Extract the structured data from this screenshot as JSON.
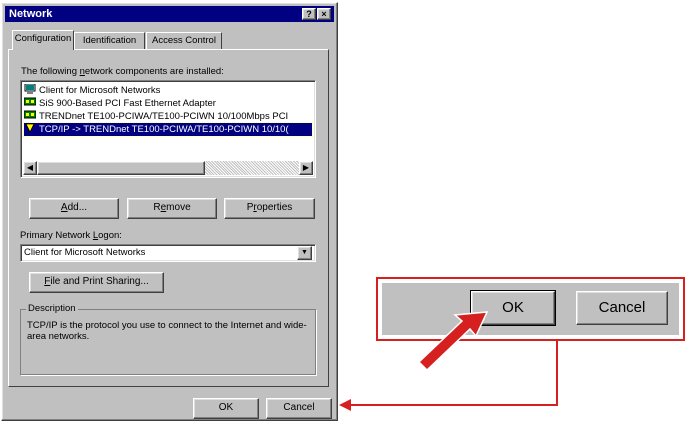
{
  "window": {
    "title": "Network",
    "help_label": "?",
    "close_label": "×"
  },
  "tabs": [
    {
      "label": "Configuration",
      "active": true
    },
    {
      "label": "Identification",
      "active": false
    },
    {
      "label": "Access Control",
      "active": false
    }
  ],
  "components": {
    "label_pre": "The following ",
    "label_ul": "n",
    "label_post": "etwork components are installed:",
    "items": [
      {
        "label": "Client for Microsoft Networks",
        "icon": "client-icon",
        "selected": false
      },
      {
        "label": "SiS 900-Based PCI Fast Ethernet Adapter",
        "icon": "network-adapter-icon",
        "selected": false
      },
      {
        "label": "TRENDnet TE100-PCIWA/TE100-PCIWN 10/100Mbps PCI",
        "icon": "network-adapter-icon",
        "selected": false
      },
      {
        "label": "TCP/IP -> TRENDnet TE100-PCIWA/TE100-PCIWN 10/10(",
        "icon": "protocol-icon",
        "selected": true
      }
    ]
  },
  "buttons": {
    "add_ul": "A",
    "add_rest": "dd...",
    "remove_pre": "R",
    "remove_ul": "e",
    "remove_post": "move",
    "properties_pre": "P",
    "properties_ul": "r",
    "properties_post": "operties",
    "file_print_ul": "F",
    "file_print_rest": "ile and Print Sharing...",
    "ok": "OK",
    "cancel": "Cancel"
  },
  "logon": {
    "label_pre": "Primary Network ",
    "label_ul": "L",
    "label_post": "ogon:",
    "value": "Client for Microsoft Networks"
  },
  "description": {
    "legend": "Description",
    "text": "TCP/IP is the protocol you use to connect to the Internet and wide-area networks."
  },
  "zoom": {
    "ok": "OK",
    "cancel": "Cancel"
  },
  "colors": {
    "accent": "#d62020",
    "title_bar": "#000080",
    "face": "#c0c0c0",
    "selection": "#000080"
  }
}
